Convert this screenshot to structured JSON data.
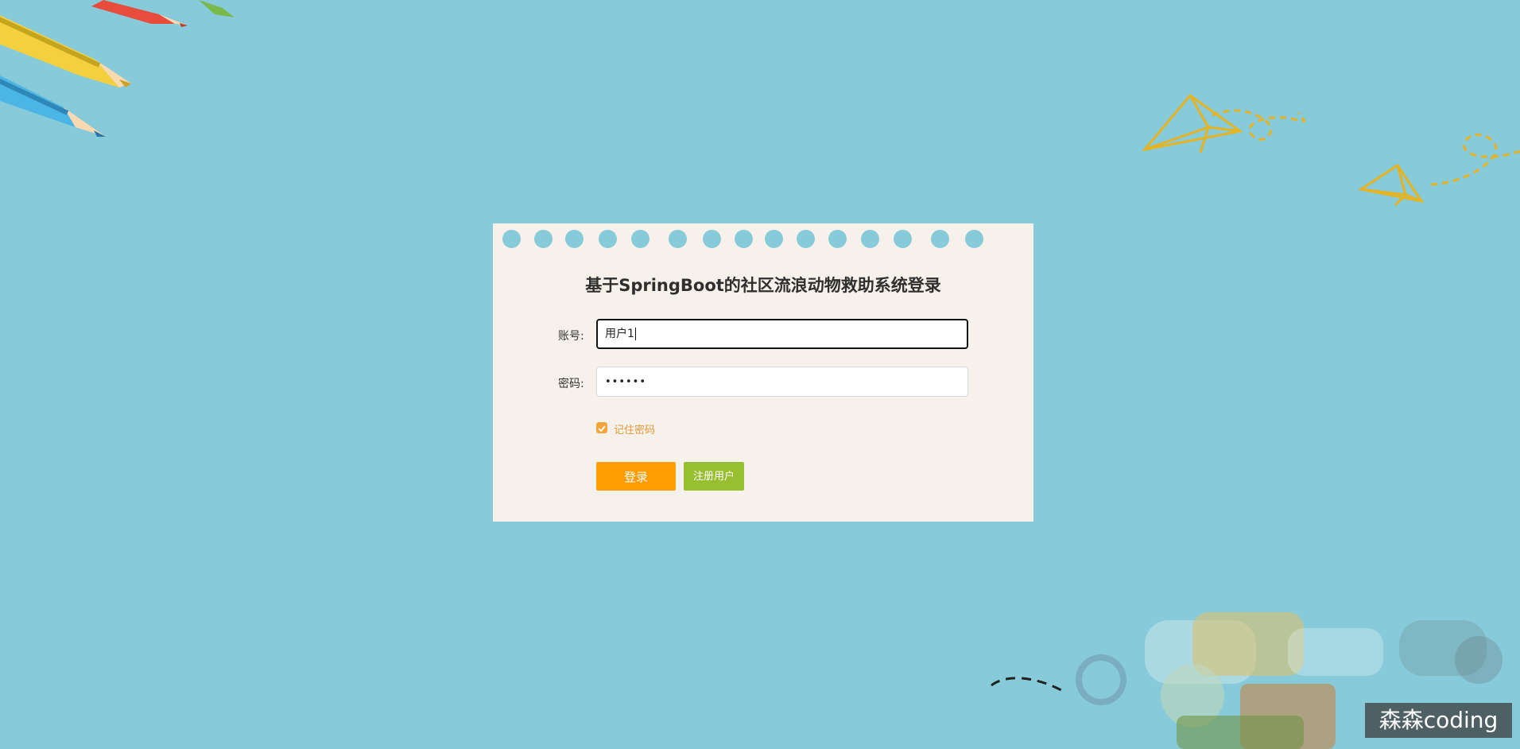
{
  "login": {
    "title": "基于SpringBoot的社区流浪动物救助系统登录",
    "account_label": "账号:",
    "account_value": "用户1",
    "password_label": "密码:",
    "password_value": "••••••",
    "remember_label": "记住密码",
    "remember_checked": true,
    "login_button": "登录",
    "register_button": "注册用户"
  },
  "watermark": {
    "text": "森森coding"
  },
  "colors": {
    "background": "#87cad9",
    "card": "#f6f1ea",
    "login_button": "#ff9c00",
    "register_button": "#98be31",
    "accent": "#f7a43a"
  },
  "decorations": [
    "pencil-icon",
    "paper-plane-icon",
    "dashed-path"
  ]
}
